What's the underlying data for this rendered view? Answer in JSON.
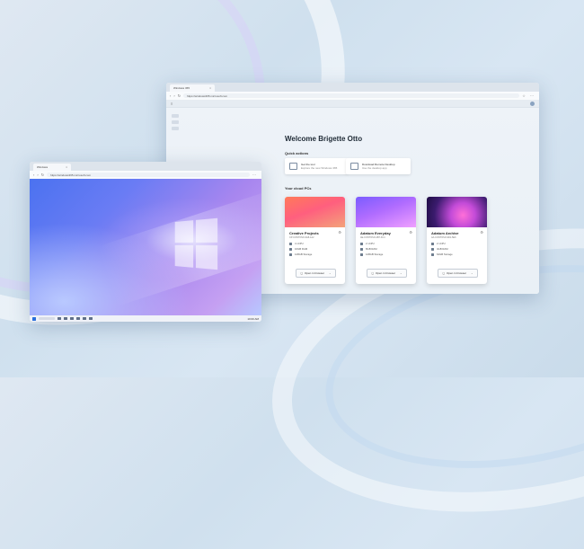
{
  "colors": {
    "accent": "#2a6fdb",
    "window_bg": "#f3f6fa"
  },
  "back_window": {
    "tab_title": "Windows 365",
    "url": "https://windows365.microsoft.com",
    "welcome": "Welcome Brigette Otto",
    "quick_actions_label": "Quick actions",
    "quick_actions": [
      {
        "title": "Get the tour",
        "subtitle": "Explore the new Windows 365",
        "icon": "monitor-icon"
      },
      {
        "title": "Download Remote Desktop",
        "subtitle": "Use the desktop app",
        "icon": "download-monitor-icon"
      }
    ],
    "cloud_pcs_label": "Your cloud PCs",
    "cloud_pcs": [
      {
        "name": "Creative Projects",
        "subtitle": "CP-CONTOSO-6A8-1A2",
        "cpu": "4 vCPU",
        "ram": "16GB RAM",
        "storage": "128GB Storage",
        "open_label": "Open in browser"
      },
      {
        "name": "Adatum Everyday",
        "subtitle": "AE-CONTOSO-2B7-3C4",
        "cpu": "2 vCPU",
        "ram": "8GB RAM",
        "storage": "128GB Storage",
        "open_label": "Open in browser"
      },
      {
        "name": "Adatum Archive",
        "subtitle": "AA-CONTOSO-9D1-5E6",
        "cpu": "2 vCPU",
        "ram": "4GB RAM",
        "storage": "64GB Storage",
        "open_label": "Open in browser"
      }
    ]
  },
  "front_window": {
    "tab_title": "Windows",
    "url": "https://windows365.microsoft.com",
    "clock": "10:00 AM"
  }
}
